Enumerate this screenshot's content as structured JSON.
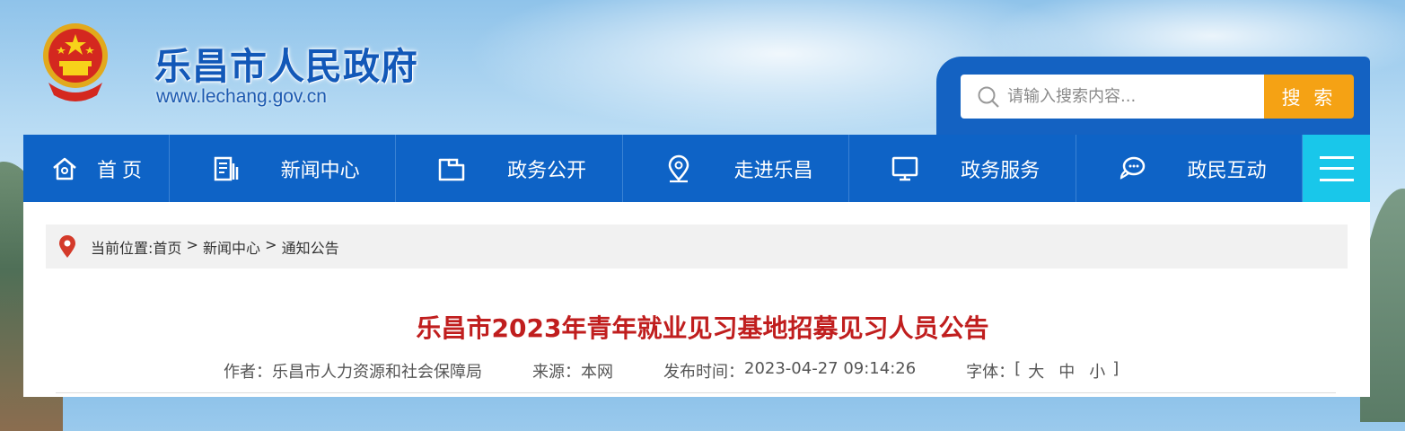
{
  "header": {
    "site_name": "乐昌市人民政府",
    "site_url": "www.lechang.gov.cn"
  },
  "search": {
    "placeholder": "请输入搜索内容...",
    "button_label": "搜 索"
  },
  "nav": {
    "items": [
      {
        "label": "首页",
        "icon": "home-icon"
      },
      {
        "label": "新闻中心",
        "icon": "news-icon"
      },
      {
        "label": "政务公开",
        "icon": "folder-icon"
      },
      {
        "label": "走进乐昌",
        "icon": "location-icon"
      },
      {
        "label": "政务服务",
        "icon": "monitor-icon"
      },
      {
        "label": "政民互动",
        "icon": "chat-icon"
      }
    ],
    "menu_icon": "menu-icon"
  },
  "breadcrumb": {
    "prefix": "当前位置:",
    "items": [
      "首页",
      "新闻中心",
      "通知公告"
    ],
    "separator": " > "
  },
  "article": {
    "title": "乐昌市2023年青年就业见习基地招募见习人员公告",
    "author_label": "作者：",
    "author": "乐昌市人力资源和社会保障局",
    "source_label": "来源：",
    "source": "本网",
    "date_label": "发布时间：",
    "date": "2023-04-27 09:14:26",
    "font_label": "字体：",
    "font_open": "[",
    "font_large": "大",
    "font_medium": "中",
    "font_small": "小",
    "font_close": "]"
  },
  "colors": {
    "nav_bg": "#0e63c6",
    "menu_bg": "#19c7ea",
    "search_button": "#f5a214",
    "title_red": "#c01e1e",
    "brand_blue": "#1258b8"
  }
}
